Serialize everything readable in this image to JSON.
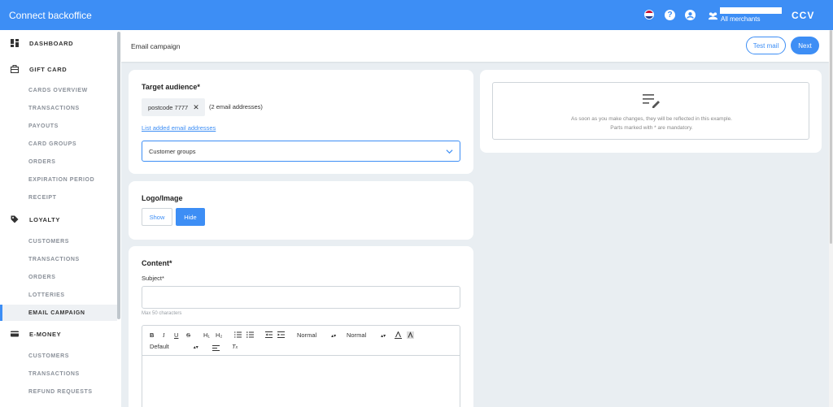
{
  "app": {
    "title": "Connect backoffice",
    "merchant_label": "All merchants",
    "logo_text": "CCV"
  },
  "sidebar": {
    "sections": [
      {
        "label": "DASHBOARD",
        "icon": "dashboard-icon",
        "items": []
      },
      {
        "label": "GIFT CARD",
        "icon": "gift-card-icon",
        "items": [
          "CARDS OVERVIEW",
          "TRANSACTIONS",
          "PAYOUTS",
          "CARD GROUPS",
          "ORDERS",
          "EXPIRATION PERIOD",
          "RECEIPT"
        ]
      },
      {
        "label": "LOYALTY",
        "icon": "loyalty-tag-icon",
        "items": [
          "CUSTOMERS",
          "TRANSACTIONS",
          "ORDERS",
          "LOTTERIES",
          "EMAIL CAMPAIGN"
        ]
      },
      {
        "label": "E-MONEY",
        "icon": "card-icon",
        "items": [
          "CUSTOMERS",
          "TRANSACTIONS",
          "REFUND REQUESTS"
        ]
      }
    ],
    "active_item": "EMAIL CAMPAIGN"
  },
  "header": {
    "title": "Email campaign",
    "test_mail_label": "Test mail",
    "next_label": "Next"
  },
  "target_audience": {
    "title": "Target audience*",
    "chip_label": "postcode 7777",
    "chip_note": "(2 email addresses)",
    "link_text": "List added email addresses",
    "select_value": "Customer groups"
  },
  "logo_image": {
    "title": "Logo/Image",
    "show_label": "Show",
    "hide_label": "Hide",
    "selected": "Hide"
  },
  "content": {
    "title": "Content*",
    "subject_label": "Subject*",
    "subject_value": "",
    "subject_hint": "Max 50 characters",
    "toolbar": {
      "bold": "B",
      "italic": "I",
      "underline": "U",
      "strike": "S",
      "h1": "H₁",
      "h2": "H₂",
      "size_select": "Normal",
      "heading_select": "Normal",
      "font_select": "Default"
    }
  },
  "preview": {
    "line1": "As soon as you make changes, they will be reflected in this example.",
    "line2": "Parts marked with * are mandatory."
  },
  "colors": {
    "primary": "#3d8ef5",
    "background": "#e9eef2"
  }
}
